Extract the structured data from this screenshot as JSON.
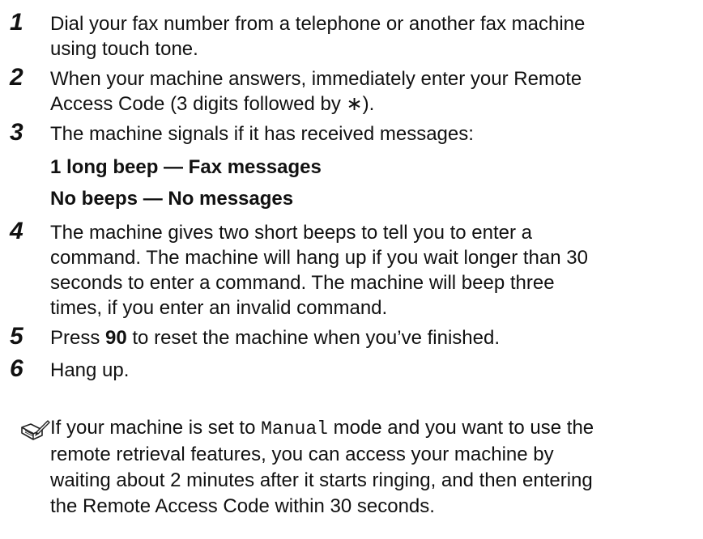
{
  "steps": [
    {
      "num": "1",
      "line1": "Dial your fax number from a telephone or another fax machine",
      "line2": "using touch tone."
    },
    {
      "num": "2",
      "line1": "When your machine answers, immediately enter your Remote",
      "line2": "Access Code (3 digits followed by ∗)."
    },
    {
      "num": "3",
      "line1": "The machine signals if it has received messages:"
    },
    {
      "num": "4",
      "line1": "The machine gives two short beeps to tell you to enter a",
      "line2": "command. The machine will hang up if you wait longer than 30",
      "line3": "seconds to enter a command. The machine will beep three",
      "line4": "times, if you enter an invalid command."
    },
    {
      "num": "5",
      "pre": "Press ",
      "bold": "90",
      "post": " to reset the machine when you’ve finished."
    },
    {
      "num": "6",
      "line1": "Hang up."
    }
  ],
  "signals": [
    "1 long beep — Fax messages",
    "No beeps — No messages"
  ],
  "note": {
    "pre": "If your machine is set to ",
    "mode": "Manual",
    "post": " mode and you want to use the",
    "line2": "remote retrieval features, you can access your machine by",
    "line3": "waiting about 2 minutes after it starts ringing, and then entering",
    "line4": "the Remote Access Code within 30 seconds."
  },
  "icons": {
    "note": "note-pencil-icon"
  }
}
